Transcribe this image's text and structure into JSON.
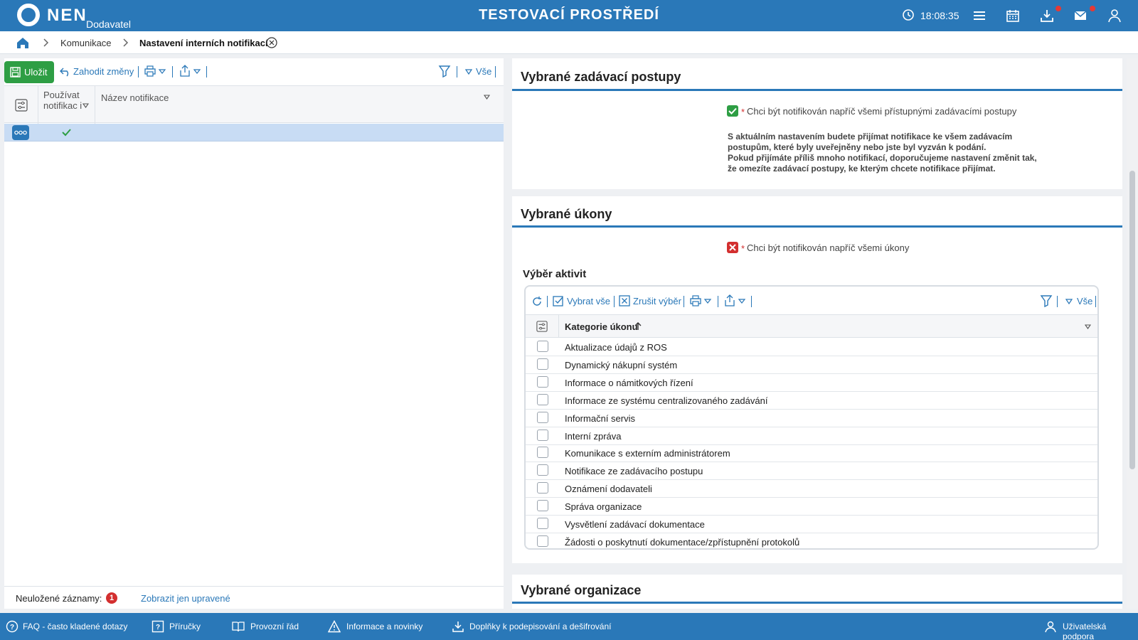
{
  "header": {
    "logo_text": "NEN",
    "logo_sub": "Dodavatel",
    "environment": "TESTOVACÍ PROSTŘEDÍ",
    "time": "18:08:35",
    "icons": [
      "clock-icon",
      "menu-icon",
      "calendar-icon",
      "download-icon",
      "mail-icon",
      "user-icon"
    ]
  },
  "breadcrumb": {
    "items": [
      "Komunikace",
      "Nastavení interních notifikací"
    ]
  },
  "left_toolbar": {
    "save_label": "Uložit",
    "discard_label": "Zahodit změny",
    "filter_all_label": "Vše"
  },
  "left_grid": {
    "columns": [
      "Používat notifikac i",
      "Název notifikace"
    ],
    "rows": [
      {
        "use": true,
        "name": ""
      }
    ]
  },
  "left_footer": {
    "unsaved_label": "Neuložené záznamy:",
    "unsaved_count": "1",
    "show_edited_link": "Zobrazit jen upravené"
  },
  "section_procedures": {
    "title": "Vybrané zadávací postupy",
    "required_mark": "*",
    "checkbox_label": "Chci být notifikován napříč všemi přístupnými zadávacími postupy",
    "checkbox_checked": true,
    "info_line1": "S aktuálním nastavením budete přijímat notifikace ke všem zadávacím",
    "info_line2": "postupům, které byly uveřejněny nebo jste byl vyzván k podání.",
    "info_line3": "Pokud přijímáte příliš mnoho notifikací, doporučujeme nastavení změnit tak,",
    "info_line4": "že omezíte zadávací postupy, ke kterým chcete notifikace přijímat."
  },
  "section_acts": {
    "title": "Vybrané úkony",
    "required_mark": "*",
    "checkbox_label": "Chci být notifikován napříč všemi úkony",
    "checkbox_checked": false,
    "subtitle": "Výběr aktivit",
    "toolbar": {
      "select_all": "Vybrat vše",
      "cancel_selection": "Zrušit výběr",
      "filter_all_label": "Vše"
    },
    "column": "Kategorie úkonu",
    "rows": [
      "Aktualizace údajů z ROS",
      "Dynamický nákupní systém",
      "Informace o námitkových řízení",
      "Informace ze systému centralizovaného zadávání",
      "Informační servis",
      "Interní zpráva",
      "Komunikace s externím administrátorem",
      "Notifikace ze zadávacího postupu",
      "Oznámení dodavateli",
      "Správa organizace",
      "Vysvětlení zadávací dokumentace",
      "Žádosti o poskytnutí dokumentace/zpřístupnění protokolů"
    ]
  },
  "section_orgs": {
    "title": "Vybrané organizace"
  },
  "footer": {
    "items": [
      "FAQ - často kladené dotazy",
      "Příručky",
      "Provozní řád",
      "Informace a novinky",
      "Doplňky k podepisování a dešifrování",
      "Uživatelská podpora"
    ]
  },
  "colors": {
    "primary": "#2a78b8",
    "success": "#2e9e44",
    "danger": "#d32f2f",
    "selected_row": "#c8dcf4"
  }
}
